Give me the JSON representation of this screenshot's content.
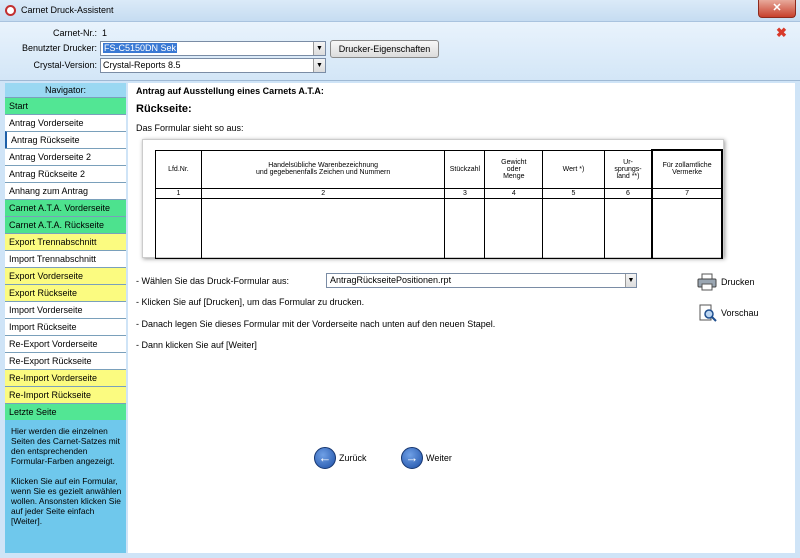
{
  "window": {
    "title": "Carnet Druck-Assistent"
  },
  "header": {
    "carnet_label": "Carnet-Nr.:",
    "carnet_value": "1",
    "printer_label": "Benutzter Drucker:",
    "printer_value": "FS-C5150DN Sek",
    "printer_props_button": "Drucker-Eigenschaften",
    "crystal_label": "Crystal-Version:",
    "crystal_value": "Crystal-Reports 8.5"
  },
  "navigator": {
    "title": "Navigator:",
    "items": [
      {
        "label": "Start",
        "color": "green-light"
      },
      {
        "label": "Antrag Vorderseite",
        "color": "white"
      },
      {
        "label": "Antrag Rückseite",
        "color": "white",
        "active": true
      },
      {
        "label": "Antrag Vorderseite 2",
        "color": "white"
      },
      {
        "label": "Antrag Rückseite 2",
        "color": "white"
      },
      {
        "label": "Anhang zum Antrag",
        "color": "white"
      },
      {
        "label": "Carnet A.T.A. Vorderseite",
        "color": "green"
      },
      {
        "label": "Carnet A.T.A. Rückseite",
        "color": "green"
      },
      {
        "label": "Export Trennabschnitt",
        "color": "yellow"
      },
      {
        "label": "Import Trennabschnitt",
        "color": "white"
      },
      {
        "label": "Export Vorderseite",
        "color": "yellow"
      },
      {
        "label": "Export Rückseite",
        "color": "yellow"
      },
      {
        "label": "Import Vorderseite",
        "color": "white"
      },
      {
        "label": "Import Rückseite",
        "color": "white"
      },
      {
        "label": "Re-Export Vorderseite",
        "color": "white"
      },
      {
        "label": "Re-Export Rückseite",
        "color": "white"
      },
      {
        "label": "Re-Import Vorderseite",
        "color": "yellow"
      },
      {
        "label": "Re-Import Rückseite",
        "color": "yellow"
      },
      {
        "label": "Letzte Seite",
        "color": "green-light"
      }
    ],
    "help_text": "Hier werden die einzelnen Seiten des Carnet-Satzes mit den entsprechenden Formular-Farben angezeigt.\n\nKlicken Sie auf ein Formular, wenn Sie es gezielt anwählen wollen. Ansonsten klicken Sie auf jeder Seite einfach [Weiter]."
  },
  "main": {
    "heading": "Antrag auf Ausstellung eines Carnets A.T.A:",
    "subheading": "Rückseite:",
    "intro": "Das Formular sieht so aus:",
    "table": {
      "headers": [
        "Lfd.Nr.",
        "Handelsübliche Warenbezeichnung\nund gegebenenfalls Zeichen und Nummern",
        "Stückzahl",
        "Gewicht\noder\nMenge",
        "Wert *)",
        "Ur-\nsprungs-\nland **)",
        "Für zollamtliche\nVermerke"
      ],
      "numbers": [
        "1",
        "2",
        "3",
        "4",
        "5",
        "6",
        "7"
      ]
    },
    "step1": "- Wählen Sie das Druck-Formular aus:",
    "form_select_value": "AntragRückseitePositionen.rpt",
    "step2": "- Klicken Sie auf [Drucken], um das Formular zu drucken.",
    "step3": "- Danach legen Sie dieses Formular mit der Vorderseite nach unten auf den neuen Stapel.",
    "step4": "- Dann klicken Sie auf [Weiter]",
    "print_button": "Drucken",
    "preview_button": "Vorschau",
    "back_button": "Zurück",
    "next_button": "Weiter"
  },
  "colors": {
    "green_light": "#52e694",
    "green": "#4de28e",
    "yellow": "#fbfb80",
    "nav_bg": "#6fc8ec",
    "window_bg": "#cfe4f7"
  }
}
